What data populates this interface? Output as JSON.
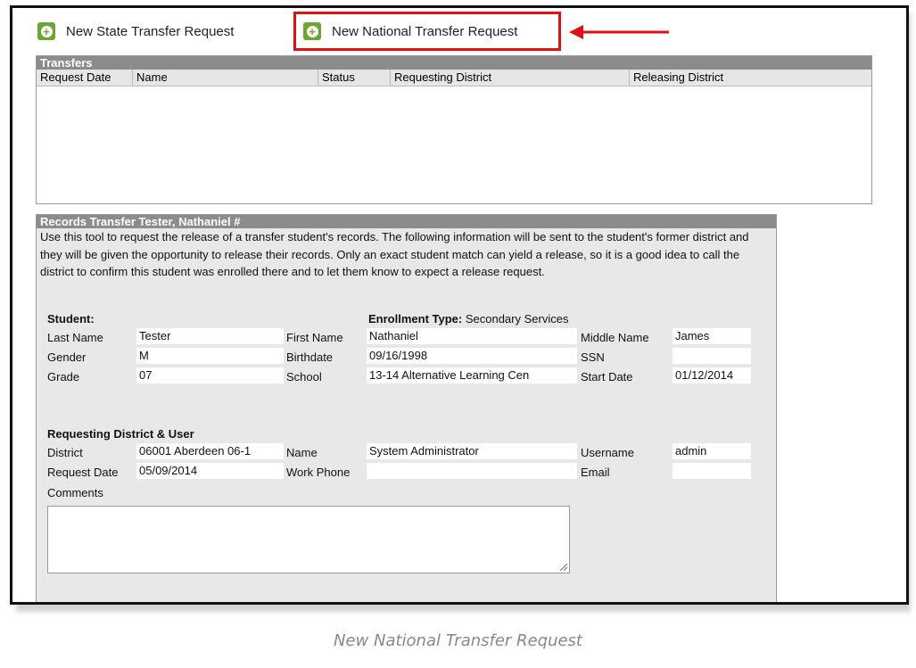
{
  "toolbar": {
    "state_label": "New State Transfer Request",
    "national_label": "New National Transfer Request"
  },
  "transfers": {
    "title": "Transfers",
    "columns": [
      "Request Date",
      "Name",
      "Status",
      "Requesting District",
      "Releasing District"
    ]
  },
  "records": {
    "title": "Records Transfer Tester, Nathaniel #",
    "intro": "Use this tool to request the release of a transfer student's records. The following information will be sent to the student's former district and they will be given the opportunity to release their records. Only an exact student match can yield a release, so it is a good idea to call the district to confirm this student was enrolled there and to let them know to expect a release request.",
    "student_heading": "Student:",
    "enrollment_type_label": "Enrollment Type:",
    "enrollment_type_value": "Secondary Services",
    "last_name_label": "Last Name",
    "last_name": "Tester",
    "first_name_label": "First Name",
    "first_name": "Nathaniel",
    "middle_name_label": "Middle Name",
    "middle_name": "James",
    "gender_label": "Gender",
    "gender": "M",
    "birthdate_label": "Birthdate",
    "birthdate": "09/16/1998",
    "ssn_label": "SSN",
    "ssn": "",
    "grade_label": "Grade",
    "grade": "07",
    "school_label": "School",
    "school": "13-14 Alternative Learning Cen",
    "start_date_label": "Start Date",
    "start_date": "01/12/2014",
    "requesting_heading": "Requesting District & User",
    "district_label": "District",
    "district": "06001 Aberdeen 06-1",
    "name_label": "Name",
    "name": "System Administrator",
    "username_label": "Username",
    "username": "admin",
    "request_date_label": "Request Date",
    "request_date": "05/09/2014",
    "work_phone_label": "Work Phone",
    "work_phone": "",
    "email_label": "Email",
    "email": "",
    "comments_label": "Comments",
    "comments": ""
  },
  "caption": "New National Transfer Request",
  "colors": {
    "accent_green": "#6aa82f",
    "highlight_red": "#e21010",
    "header_gray": "#8c8c8c"
  }
}
